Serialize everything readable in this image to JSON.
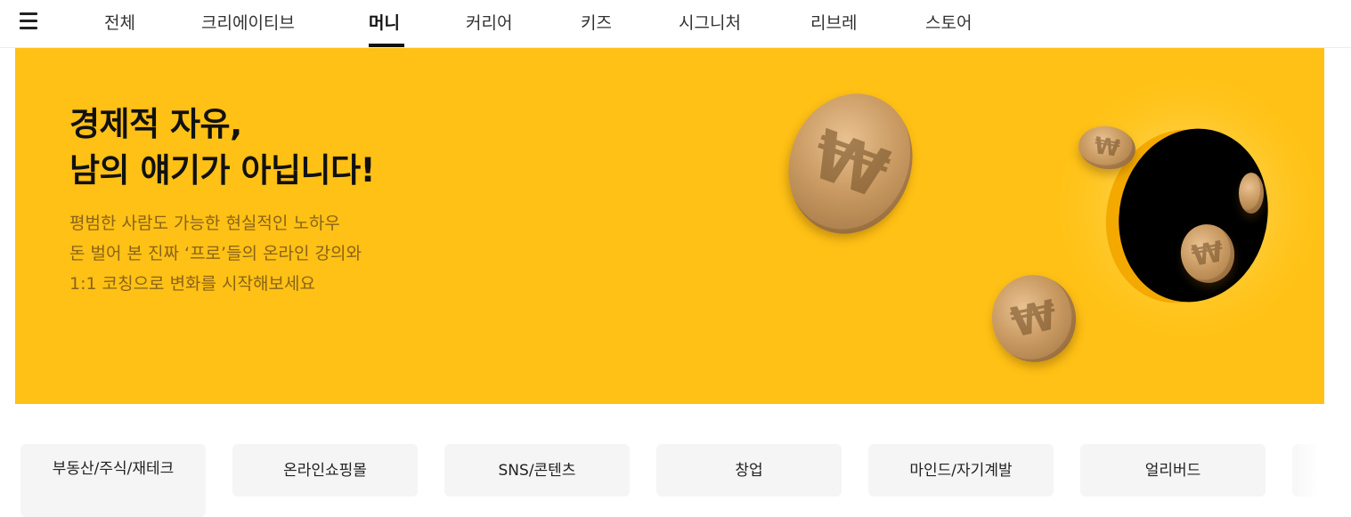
{
  "nav": {
    "menu_icon": "hamburger-menu-icon",
    "tabs": [
      {
        "label": "전체"
      },
      {
        "label": "크리에이티브"
      },
      {
        "label": "머니"
      },
      {
        "label": "커리어"
      },
      {
        "label": "키즈"
      },
      {
        "label": "시그니처"
      },
      {
        "label": "리브레"
      },
      {
        "label": "스토어"
      }
    ],
    "active_tab": "머니"
  },
  "hero": {
    "title_line1": "경제적 자유,",
    "title_line2": "남의 얘기가 아닙니다!",
    "subtitle_line1": "평범한 사람도 가능한 현실적인 노하우",
    "subtitle_line2": "돈 벌어 본 진짜 ‘프로’들의 온라인 강의와",
    "subtitle_line3": "1:1 코칭으로 변화를 시작해보세요",
    "background_color": "#ffc115",
    "coin_symbol": "₩"
  },
  "categories": [
    {
      "label": "부동산/주식/재테크"
    },
    {
      "label": "온라인쇼핑몰"
    },
    {
      "label": "SNS/콘텐츠"
    },
    {
      "label": "창업"
    },
    {
      "label": "마인드/자기계발"
    },
    {
      "label": "얼리버드"
    }
  ]
}
